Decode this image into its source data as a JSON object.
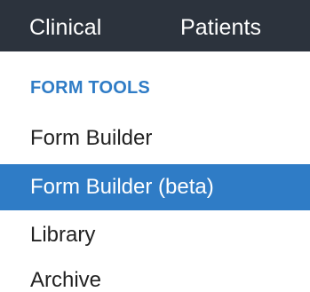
{
  "topbar": {
    "tabs": [
      {
        "label": "Clinical"
      },
      {
        "label": "Patients"
      }
    ]
  },
  "sidebar": {
    "section_heading": "FORM TOOLS",
    "items": [
      {
        "label": "Form Builder",
        "active": false
      },
      {
        "label": "Form Builder (beta)",
        "active": true
      },
      {
        "label": "Library",
        "active": false
      },
      {
        "label": "Archive",
        "active": false
      }
    ]
  },
  "colors": {
    "topbar_bg": "#2c333d",
    "accent": "#2f7cc6",
    "active_text": "#ffffff",
    "item_text": "#222222"
  }
}
